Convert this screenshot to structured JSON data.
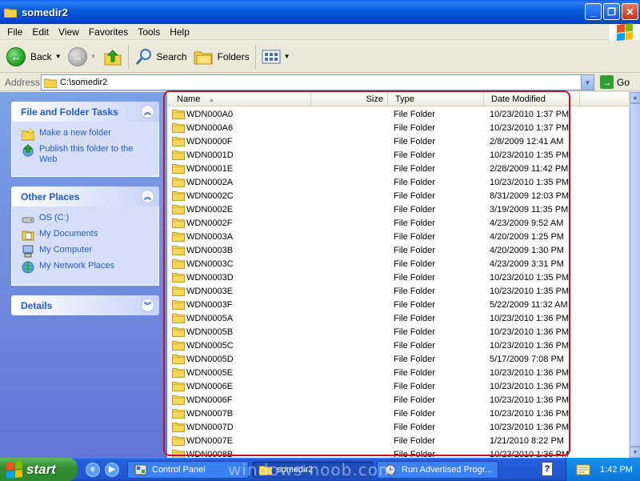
{
  "window": {
    "title": "somedir2"
  },
  "menu": [
    "File",
    "Edit",
    "View",
    "Favorites",
    "Tools",
    "Help"
  ],
  "toolbar": {
    "back": "Back",
    "search": "Search",
    "folders": "Folders"
  },
  "address": {
    "label": "Address",
    "value": "C:\\somedir2",
    "go": "Go"
  },
  "tasks_panel": {
    "title": "File and Folder Tasks",
    "items": [
      "Make a new folder",
      "Publish this folder to the Web"
    ]
  },
  "places_panel": {
    "title": "Other Places",
    "items": [
      "OS (C:)",
      "My Documents",
      "My Computer",
      "My Network Places"
    ]
  },
  "details_panel": {
    "title": "Details"
  },
  "columns": {
    "name": "Name",
    "size": "Size",
    "type": "Type",
    "date": "Date Modified"
  },
  "files": [
    {
      "name": "WDN000A0",
      "type": "File Folder",
      "date": "10/23/2010 1:37 PM"
    },
    {
      "name": "WDN000A6",
      "type": "File Folder",
      "date": "10/23/2010 1:37 PM"
    },
    {
      "name": "WDN0000F",
      "type": "File Folder",
      "date": "2/8/2009 12:41 AM"
    },
    {
      "name": "WDN0001D",
      "type": "File Folder",
      "date": "10/23/2010 1:35 PM"
    },
    {
      "name": "WDN0001E",
      "type": "File Folder",
      "date": "2/28/2009 11:42 PM"
    },
    {
      "name": "WDN0002A",
      "type": "File Folder",
      "date": "10/23/2010 1:35 PM"
    },
    {
      "name": "WDN0002C",
      "type": "File Folder",
      "date": "8/31/2009 12:03 PM"
    },
    {
      "name": "WDN0002E",
      "type": "File Folder",
      "date": "3/19/2009 11:35 PM"
    },
    {
      "name": "WDN0002F",
      "type": "File Folder",
      "date": "4/23/2009 9:52 AM"
    },
    {
      "name": "WDN0003A",
      "type": "File Folder",
      "date": "4/20/2009 1:25 PM"
    },
    {
      "name": "WDN0003B",
      "type": "File Folder",
      "date": "4/20/2009 1:30 PM"
    },
    {
      "name": "WDN0003C",
      "type": "File Folder",
      "date": "4/23/2009 3:31 PM"
    },
    {
      "name": "WDN0003D",
      "type": "File Folder",
      "date": "10/23/2010 1:35 PM"
    },
    {
      "name": "WDN0003E",
      "type": "File Folder",
      "date": "10/23/2010 1:35 PM"
    },
    {
      "name": "WDN0003F",
      "type": "File Folder",
      "date": "5/22/2009 11:32 AM"
    },
    {
      "name": "WDN0005A",
      "type": "File Folder",
      "date": "10/23/2010 1:36 PM"
    },
    {
      "name": "WDN0005B",
      "type": "File Folder",
      "date": "10/23/2010 1:36 PM"
    },
    {
      "name": "WDN0005C",
      "type": "File Folder",
      "date": "10/23/2010 1:36 PM"
    },
    {
      "name": "WDN0005D",
      "type": "File Folder",
      "date": "5/17/2009 7:08 PM"
    },
    {
      "name": "WDN0005E",
      "type": "File Folder",
      "date": "10/23/2010 1:36 PM"
    },
    {
      "name": "WDN0006E",
      "type": "File Folder",
      "date": "10/23/2010 1:36 PM"
    },
    {
      "name": "WDN0006F",
      "type": "File Folder",
      "date": "10/23/2010 1:36 PM"
    },
    {
      "name": "WDN0007B",
      "type": "File Folder",
      "date": "10/23/2010 1:36 PM"
    },
    {
      "name": "WDN0007D",
      "type": "File Folder",
      "date": "10/23/2010 1:36 PM"
    },
    {
      "name": "WDN0007E",
      "type": "File Folder",
      "date": "1/21/2010 8:22 PM"
    },
    {
      "name": "WDN0008B",
      "type": "File Folder",
      "date": "10/23/2010 1:36 PM"
    }
  ],
  "taskbar": {
    "start": "start",
    "buttons": [
      "Control Panel",
      "somedir2",
      "Run Advertised Progr..."
    ],
    "clock": "1:42 PM",
    "help": "?",
    "watermark": "windows-noob.com"
  },
  "colors": {
    "accent": "#215dc6",
    "highlight_border": "#c8102e",
    "title_bar": "#0858dd"
  }
}
